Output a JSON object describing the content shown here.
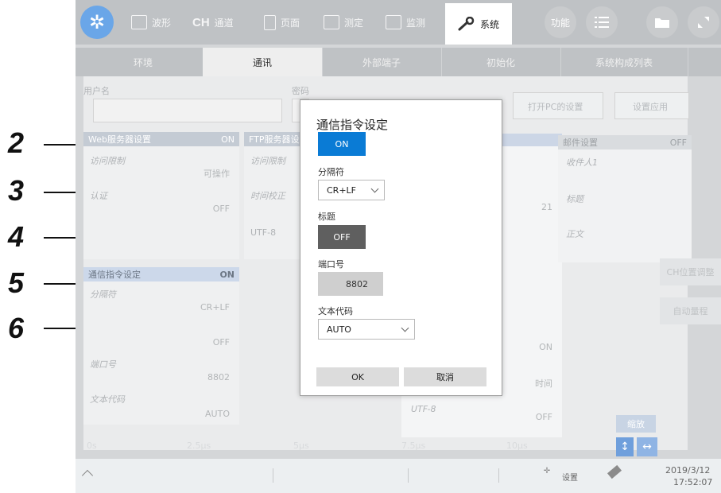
{
  "callouts": [
    "2",
    "3",
    "4",
    "5",
    "6"
  ],
  "toolbar": {
    "tabs": [
      {
        "icon": "waveform-icon",
        "label": "波形"
      },
      {
        "icon": "ch-icon",
        "prefix": "CH",
        "label": "通道"
      },
      {
        "icon": "page-icon",
        "label": "页面"
      },
      {
        "icon": "measure-icon",
        "label": "测定"
      },
      {
        "icon": "monitor-icon",
        "label": "监测"
      }
    ],
    "system_label": "系统",
    "func_label": "功能"
  },
  "subtabs": [
    "环境",
    "通讯",
    "外部端子",
    "初始化",
    "系统构成列表"
  ],
  "background": {
    "user_label": "用户名",
    "password_label": "密码",
    "open_pc_button": "打开PC的设置",
    "apply_button": "设置应用",
    "panel1_header": "Web服务器设置",
    "panel1_header_val": "ON",
    "panel2_header": "FTP服务器设置",
    "access_label": "访问限制",
    "access_value": "可操作",
    "auth_label": "认证",
    "auth_value": "OFF",
    "access_label2": "访问限制",
    "time_label": "时间校正",
    "utf_label": "UTF-8",
    "cmd_header": "通信指令设定",
    "cmd_header_val": "ON",
    "cmd_rows": [
      {
        "label": "分隔符",
        "value": "CR+LF"
      },
      {
        "label": "标题",
        "value": "OFF"
      },
      {
        "label": "端口号",
        "value": "8802"
      },
      {
        "label": "文本代码",
        "value": "AUTO"
      }
    ],
    "mid_value_21": "21",
    "mid_on": "ON",
    "mid_time": "时间",
    "mid_utf": "UTF-8",
    "mid_off": "OFF",
    "mail_header": "邮件设置",
    "mail_header_val": "OFF",
    "mail_rows": [
      "收件人1",
      "标题",
      "正文"
    ],
    "side_buttons": [
      "CH位置调整",
      "自动量程"
    ],
    "axis_ticks": [
      "0s",
      "2.5μs",
      "5μs",
      "7.5μs",
      "10μs"
    ],
    "zoom_label": "缩放"
  },
  "statusbar": {
    "settings_label": "设置",
    "date": "2019/3/12",
    "time": "17:52:07"
  },
  "dialog": {
    "title": "通信指令设定",
    "enable_toggle": "ON",
    "delimiter_label": "分隔符",
    "delimiter_value": "CR+LF",
    "header_label": "标题",
    "header_toggle": "OFF",
    "port_label": "端口号",
    "port_value": "8802",
    "textcode_label": "文本代码",
    "textcode_value": "AUTO",
    "ok_button": "OK",
    "cancel_button": "取消"
  },
  "colors": {
    "accent_blue": "#0a7bd5",
    "toggle_off": "#5f5f5f",
    "port_bg": "#cfcfcf"
  }
}
